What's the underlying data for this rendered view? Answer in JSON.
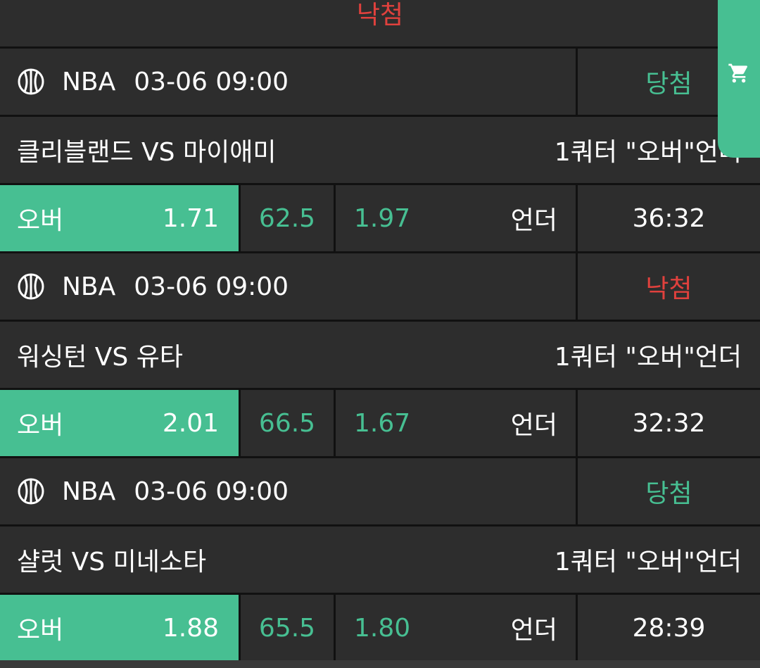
{
  "top_partial_result": {
    "label": "낙첨",
    "color": "#e0413d"
  },
  "cart_icon": "shopping-cart-icon",
  "colors": {
    "accent": "#47bf92",
    "lost": "#e0413d",
    "panel": "#2d2d2d",
    "divider": "#111111"
  },
  "bets": [
    {
      "league": "NBA",
      "datetime": "03-06 09:00",
      "result": "당첨",
      "result_status": "won",
      "teams": "클리블랜드 VS 마이애미",
      "market": "1쿼터 \"오버\"언더",
      "over_label": "오버",
      "over_odds": "1.71",
      "line": "62.5",
      "under_odds": "1.97",
      "under_label": "언더",
      "time": "36:32"
    },
    {
      "league": "NBA",
      "datetime": "03-06 09:00",
      "result": "낙첨",
      "result_status": "lost",
      "teams": "워싱턴 VS 유타",
      "market": "1쿼터 \"오버\"언더",
      "over_label": "오버",
      "over_odds": "2.01",
      "line": "66.5",
      "under_odds": "1.67",
      "under_label": "언더",
      "time": "32:32"
    },
    {
      "league": "NBA",
      "datetime": "03-06 09:00",
      "result": "당첨",
      "result_status": "won",
      "teams": "샬럿 VS 미네소타",
      "market": "1쿼터 \"오버\"언더",
      "over_label": "오버",
      "over_odds": "1.88",
      "line": "65.5",
      "under_odds": "1.80",
      "under_label": "언더",
      "time": "28:39"
    }
  ]
}
